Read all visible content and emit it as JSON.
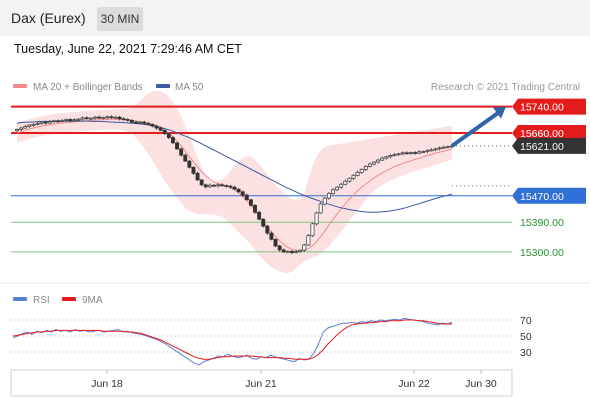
{
  "header": {
    "title": "Dax (Eurex)",
    "timeframe": "30 MIN"
  },
  "datetime": "Tuesday, June 22, 2021 7:29:46 AM CET",
  "legend": {
    "ma20": "MA 20 + Bollinger Bands",
    "ma50": "MA 50",
    "copyright": "Research © 2021 Trading Central"
  },
  "rsi_legend": {
    "rsi": "RSI",
    "ma9": "9MA"
  },
  "colors": {
    "resistance": "#e31b1b",
    "current": "#333333",
    "support_blue": "#2f6fd6",
    "support_green": "#7cc47f",
    "bb_fill": "#f9d7d7",
    "ma20": "#f28a8a",
    "ma50": "#3a5aa5",
    "rsi": "#5b7fd6",
    "rsi_ma": "#e31b1b",
    "arrow": "#2f64a8"
  },
  "chart_data": [
    {
      "type": "candlestick",
      "title": "Dax (Eurex)",
      "x_ticks": [
        "Jun 18",
        "Jun 21",
        "Jun 22",
        "Jun 30"
      ],
      "ylim": [
        15215,
        15775
      ],
      "levels": [
        {
          "value": 15740.0,
          "label": "15740.00",
          "kind": "resistance"
        },
        {
          "value": 15660.0,
          "label": "15660.00",
          "kind": "resistance"
        },
        {
          "value": 15621.0,
          "label": "15621.00",
          "kind": "current"
        },
        {
          "value": 15470.0,
          "label": "15470.00",
          "kind": "support_blue"
        },
        {
          "value": 15390.0,
          "label": "15390.00",
          "kind": "support_green"
        },
        {
          "value": 15300.0,
          "label": "15300.00",
          "kind": "support_green"
        }
      ],
      "close": [
        15671,
        15675,
        15680,
        15684,
        15686,
        15689,
        15693,
        15690,
        15694,
        15697,
        15695,
        15698,
        15701,
        15697,
        15700,
        15702,
        15706,
        15703,
        15705,
        15708,
        15705,
        15707,
        15709,
        15706,
        15708,
        15703,
        15701,
        15698,
        15693,
        15690,
        15693,
        15689,
        15686,
        15681,
        15675,
        15668,
        15658,
        15646,
        15630,
        15612,
        15593,
        15575,
        15556,
        15538,
        15518,
        15503,
        15497,
        15502,
        15500,
        15503,
        15501,
        15499,
        15496,
        15490,
        15482,
        15472,
        15458,
        15441,
        15420,
        15399,
        15378,
        15357,
        15338,
        15318,
        15306,
        15300,
        15302,
        15298,
        15301,
        15305,
        15321,
        15349,
        15385,
        15418,
        15445,
        15463,
        15477,
        15488,
        15496,
        15505,
        15514,
        15523,
        15532,
        15541,
        15550,
        15559,
        15566,
        15572,
        15578,
        15584,
        15588,
        15592,
        15595,
        15597,
        15600,
        15598,
        15601,
        15599,
        15603,
        15604,
        15607,
        15609,
        15612,
        15615,
        15617,
        15619,
        15621
      ],
      "ma20": [
        15660,
        15664,
        15668,
        15672,
        15675,
        15678,
        15681,
        15683,
        15685,
        15687,
        15689,
        15690,
        15691,
        15693,
        15694,
        15695,
        15696,
        15697,
        15698,
        15699,
        15700,
        15700,
        15701,
        15701,
        15702,
        15701,
        15700,
        15699,
        15698,
        15696,
        15694,
        15692,
        15689,
        15686,
        15682,
        15676,
        15669,
        15660,
        15649,
        15636,
        15621,
        15605,
        15588,
        15572,
        15557,
        15543,
        15530,
        15520,
        15512,
        15507,
        15503,
        15500,
        15495,
        15488,
        15479,
        15468,
        15455,
        15441,
        15425,
        15408,
        15392,
        15376,
        15361,
        15347,
        15334,
        15323,
        15314,
        15308,
        15305,
        15303,
        15305,
        15310,
        15319,
        15331,
        15346,
        15363,
        15381,
        15398,
        15415,
        15431,
        15446,
        15460,
        15473,
        15485,
        15496,
        15506,
        15515,
        15524,
        15532,
        15539,
        15546,
        15552,
        15558,
        15563,
        15568,
        15572,
        15576,
        15580,
        15584,
        15588,
        15592,
        15595,
        15599,
        15602,
        15605,
        15608,
        15611
      ],
      "ma50": [
        15690,
        15692,
        15693,
        15694,
        15695,
        15695,
        15696,
        15696,
        15696,
        15696,
        15696,
        15696,
        15695,
        15695,
        15694,
        15693,
        15692,
        15691,
        15690,
        15688,
        15686,
        15683,
        15679,
        15674,
        15668,
        15661,
        15653,
        15645,
        15636,
        15626,
        15616,
        15606,
        15596,
        15586,
        15576,
        15566,
        15556,
        15546,
        15536,
        15526,
        15516,
        15506,
        15496,
        15487,
        15478,
        15470,
        15463,
        15456,
        15449,
        15443,
        15437,
        15432,
        15428,
        15425,
        15422,
        15420,
        15420,
        15421,
        15423,
        15426,
        15430,
        15435,
        15441,
        15447,
        15453,
        15459,
        15465,
        15470,
        15475
      ],
      "bb_upper": [
        15690,
        15694,
        15698,
        15702,
        15705,
        15708,
        15711,
        15713,
        15715,
        15717,
        15719,
        15720,
        15721,
        15723,
        15724,
        15725,
        15726,
        15727,
        15728,
        15729,
        15730,
        15730,
        15731,
        15731,
        15732,
        15732,
        15733,
        15734,
        15738,
        15746,
        15758,
        15770,
        15780,
        15786,
        15788,
        15786,
        15780,
        15770,
        15755,
        15735,
        15710,
        15682,
        15650,
        15617,
        15585,
        15555,
        15530,
        15515,
        15510,
        15515,
        15520,
        15530,
        15545,
        15560,
        15575,
        15585,
        15590,
        15588,
        15580,
        15568,
        15552,
        15535,
        15518,
        15503,
        15490,
        15478,
        15468,
        15460,
        15456,
        15460,
        15480,
        15520,
        15560,
        15588,
        15608,
        15618,
        15622,
        15624,
        15626,
        15628,
        15630,
        15632,
        15634,
        15636,
        15638,
        15640,
        15642,
        15644,
        15646,
        15648,
        15650,
        15652,
        15654,
        15656,
        15658,
        15660,
        15662,
        15664,
        15666,
        15668,
        15670,
        15672,
        15674,
        15676,
        15678,
        15680,
        15682
      ],
      "bb_lower": [
        15630,
        15634,
        15638,
        15642,
        15645,
        15648,
        15651,
        15653,
        15655,
        15657,
        15659,
        15660,
        15661,
        15663,
        15664,
        15665,
        15666,
        15667,
        15668,
        15669,
        15670,
        15670,
        15671,
        15671,
        15672,
        15670,
        15667,
        15664,
        15658,
        15646,
        15630,
        15614,
        15596,
        15576,
        15556,
        15536,
        15516,
        15498,
        15480,
        15464,
        15448,
        15434,
        15424,
        15418,
        15415,
        15414,
        15414,
        15413,
        15412,
        15410,
        15405,
        15396,
        15385,
        15372,
        15360,
        15348,
        15336,
        15322,
        15306,
        15290,
        15276,
        15264,
        15254,
        15246,
        15240,
        15236,
        15236,
        15240,
        15250,
        15262,
        15272,
        15278,
        15282,
        15288,
        15296,
        15306,
        15318,
        15332,
        15346,
        15362,
        15378,
        15394,
        15410,
        15426,
        15442,
        15458,
        15472,
        15484,
        15494,
        15502,
        15510,
        15516,
        15522,
        15528,
        15532,
        15536,
        15540,
        15544,
        15548,
        15552,
        15556,
        15560,
        15564,
        15568,
        15572,
        15576,
        15580
      ]
    },
    {
      "type": "line",
      "title": "RSI",
      "ylim": [
        10,
        80
      ],
      "y_ticks": [
        70,
        50,
        30
      ],
      "rsi": [
        48,
        50,
        53,
        55,
        52,
        56,
        54,
        57,
        55,
        58,
        56,
        57,
        55,
        58,
        56,
        57,
        55,
        56,
        57,
        55,
        56,
        57,
        58,
        55,
        56,
        54,
        53,
        52,
        50,
        48,
        46,
        43,
        40,
        36,
        32,
        28,
        24,
        20,
        16,
        14,
        18,
        20,
        22,
        25,
        24,
        27,
        25,
        23,
        24,
        26,
        22,
        21,
        24,
        23,
        26,
        24,
        22,
        21,
        19,
        18,
        22,
        20,
        21,
        28,
        40,
        55,
        60,
        62,
        64,
        66,
        66,
        67,
        66,
        68,
        67,
        69,
        68,
        70,
        69,
        70,
        71,
        70,
        72,
        71,
        70,
        69,
        68,
        66,
        65,
        64,
        66,
        65,
        67
      ],
      "ma9": [
        50,
        51,
        52,
        53,
        54,
        55,
        55,
        56,
        56,
        57,
        57,
        57,
        57,
        57,
        57,
        57,
        57,
        57,
        57,
        56,
        56,
        56,
        56,
        56,
        55,
        55,
        54,
        53,
        51,
        49,
        47,
        45,
        42,
        39,
        36,
        33,
        30,
        27,
        24,
        22,
        21,
        21,
        22,
        23,
        24,
        24,
        25,
        25,
        25,
        25,
        25,
        24,
        24,
        23,
        23,
        23,
        23,
        22,
        22,
        21,
        21,
        21,
        21,
        23,
        27,
        33,
        40,
        46,
        52,
        57,
        61,
        64,
        65,
        66,
        66,
        67,
        67,
        68,
        68,
        69,
        69,
        69,
        70,
        70,
        70,
        69,
        69,
        68,
        67,
        66,
        65,
        65,
        65
      ]
    }
  ]
}
